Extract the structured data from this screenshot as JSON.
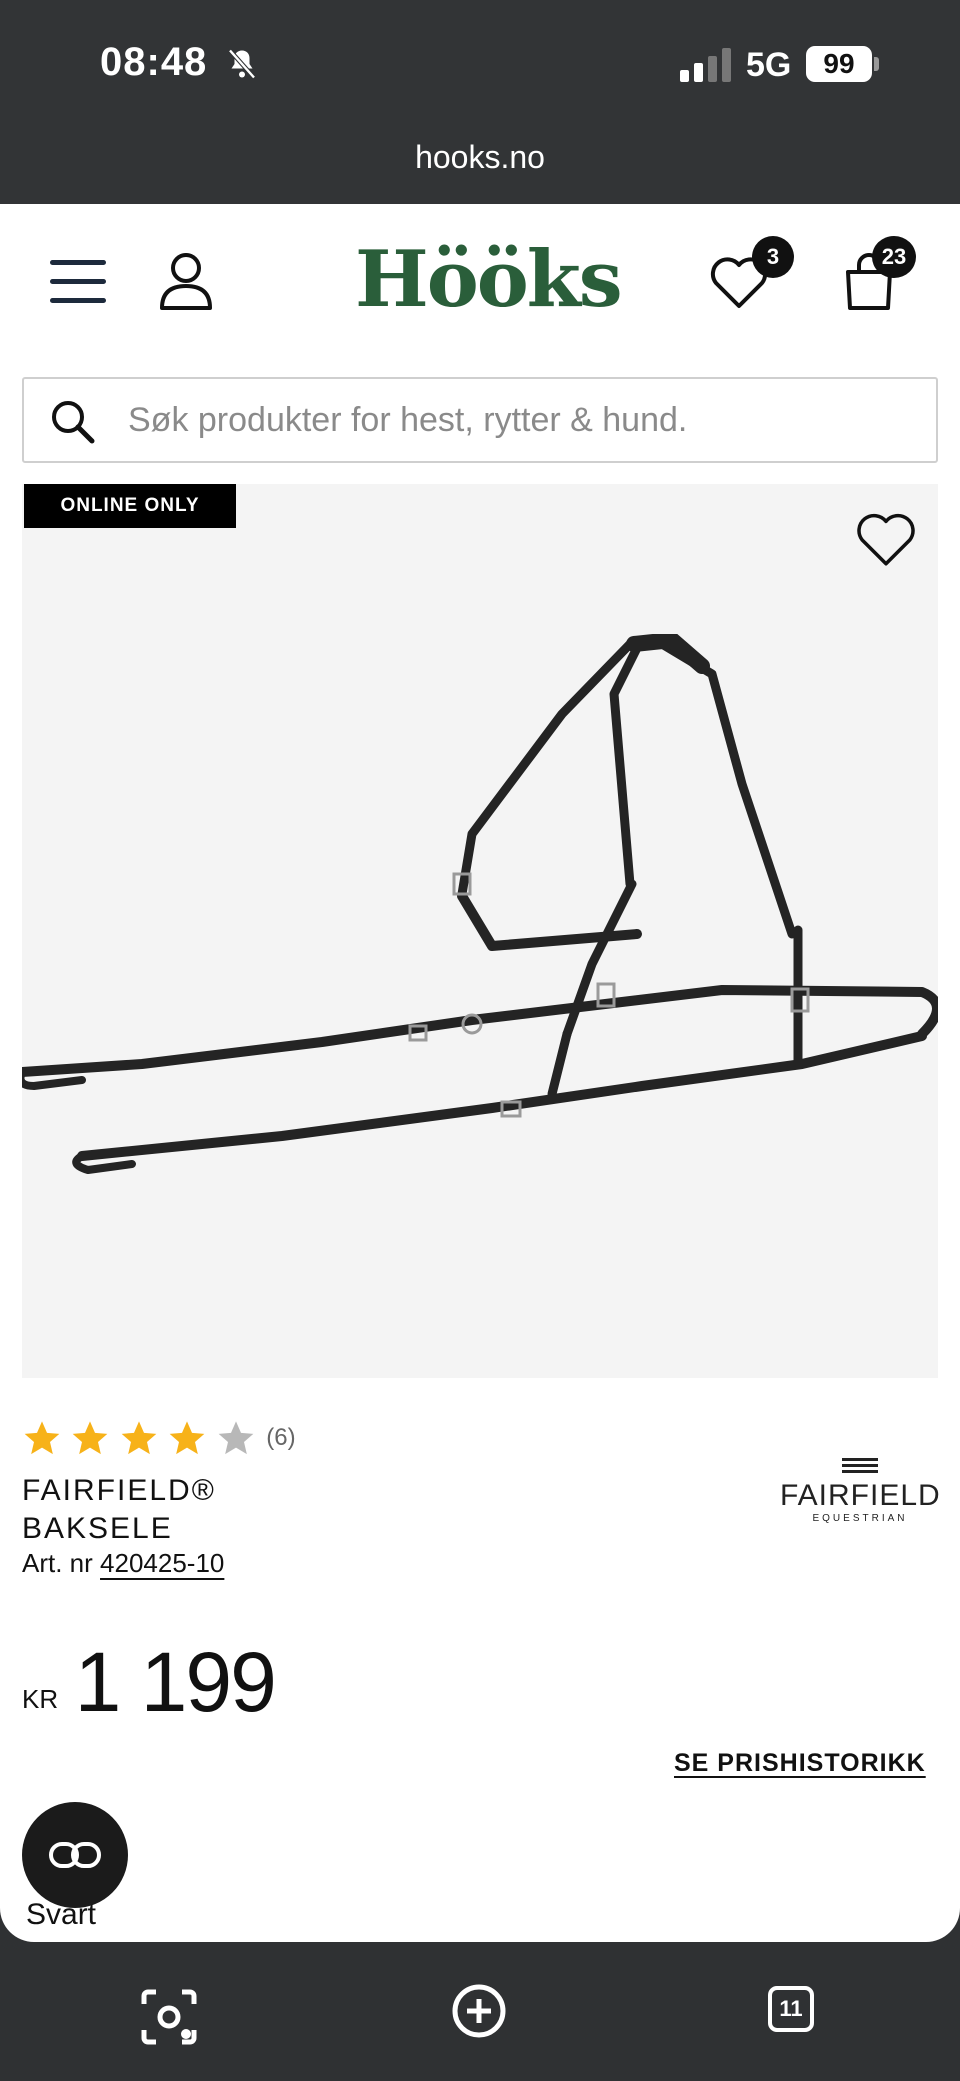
{
  "status_bar": {
    "time": "08:48",
    "network": "5G",
    "battery": "99"
  },
  "browser": {
    "url": "hooks.no",
    "tab_count": "11"
  },
  "header": {
    "logo": "Hööks",
    "wishlist_count": "3",
    "cart_count": "23"
  },
  "search": {
    "placeholder": "Søk produkter for hest, rytter & hund.",
    "value": ""
  },
  "product": {
    "badge": "ONLINE ONLY",
    "rating": 4,
    "rating_max": 5,
    "review_count": "(6)",
    "name_line1": "FAIRFIELD®",
    "name_line2": "BAKSELE",
    "art_label": "Art. nr",
    "art_number": "420425-10",
    "brand": {
      "name": "FAIRFIELD",
      "sub": "EQUESTRIAN"
    },
    "currency": "KR",
    "price": "1 199",
    "price_history_link": "SE PRISHISTORIKK",
    "color_label": "Svart"
  },
  "colors": {
    "logo_green": "#2a5e3a",
    "star_filled": "#f7b219",
    "star_empty": "#b8b8b8",
    "status_bg": "#323436"
  }
}
